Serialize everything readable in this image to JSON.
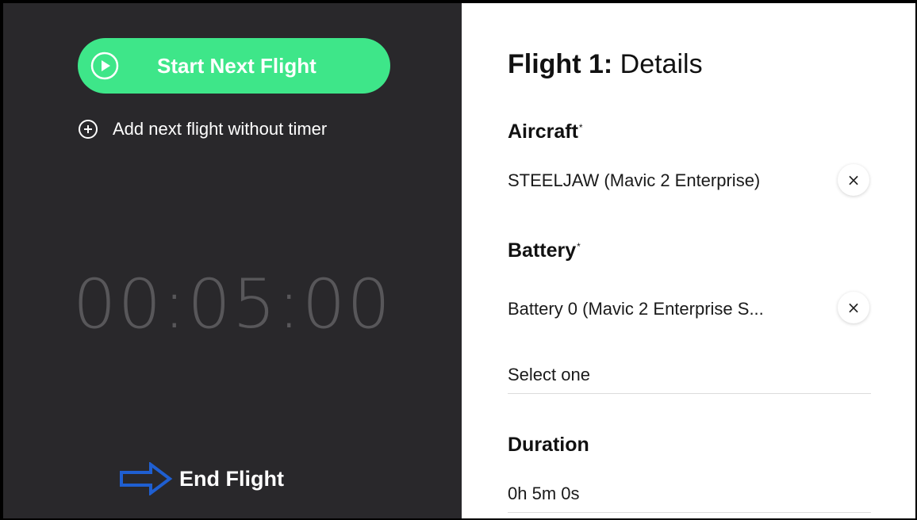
{
  "left_panel": {
    "start_button_label": "Start Next Flight",
    "add_flight_label": "Add next flight without timer",
    "timer": "00:05:00",
    "end_flight_label": "End Flight"
  },
  "details": {
    "title_bold": "Flight 1:",
    "title_rest": " Details",
    "aircraft": {
      "label": "Aircraft",
      "required_mark": "*",
      "value": "STEELJAW (Mavic 2 Enterprise)",
      "clear_icon": "×"
    },
    "battery": {
      "label": "Battery",
      "required_mark": "*",
      "value": "Battery 0 (Mavic 2 Enterprise S...",
      "clear_icon": "×",
      "select_placeholder": "Select one"
    },
    "duration": {
      "label": "Duration",
      "value": "0h 5m 0s"
    }
  },
  "colors": {
    "accent_green": "#3ee689",
    "left_bg": "#29282b",
    "arrow_blue": "#1f5fd1"
  },
  "icons": {
    "play": "play-circle-icon",
    "plus": "plus-circle-icon",
    "arrow": "right-arrow-icon",
    "clear": "close-icon"
  }
}
